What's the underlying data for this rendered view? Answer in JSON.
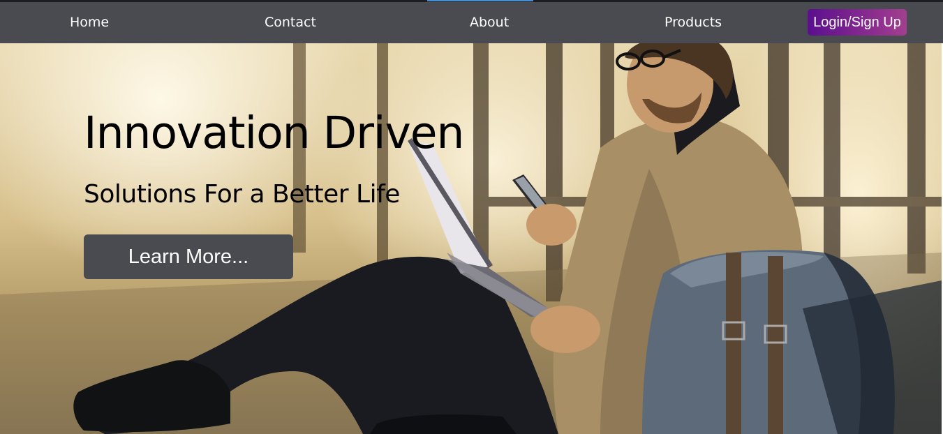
{
  "nav": {
    "items": [
      {
        "label": "Home"
      },
      {
        "label": "Contact"
      },
      {
        "label": "About"
      },
      {
        "label": "Products"
      }
    ],
    "login_label": "Login/Sign Up"
  },
  "hero": {
    "title": "Innovation Driven",
    "subtitle": "Solutions For a Better Life",
    "cta_label": "Learn More..."
  },
  "colors": {
    "navbar_bg": "#4a4b50",
    "login_gradient_start": "#5b0f8e",
    "login_gradient_end": "#a23f8e",
    "cta_bg": "#4a4b50",
    "hero_text": "#000000"
  },
  "icons": {
    "hero_image": "man-with-laptop-photo"
  }
}
